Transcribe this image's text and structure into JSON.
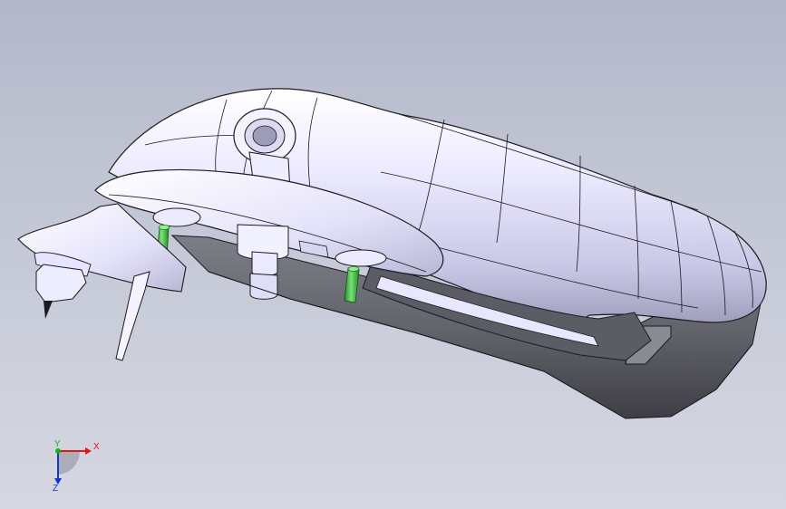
{
  "triad": {
    "x_label": "X",
    "y_label": "Y",
    "z_label": "Z",
    "x_color": "#e01818",
    "y_color": "#18b018",
    "z_color": "#1830d8"
  },
  "colors": {
    "background_top": "#b3b8c9",
    "background_bottom": "#d5d8e1",
    "shell_light": "#f2f1ff",
    "shell_shade": "#6e6e78",
    "edge_line": "#1a1a22",
    "pin_green": "#2fb52f"
  }
}
